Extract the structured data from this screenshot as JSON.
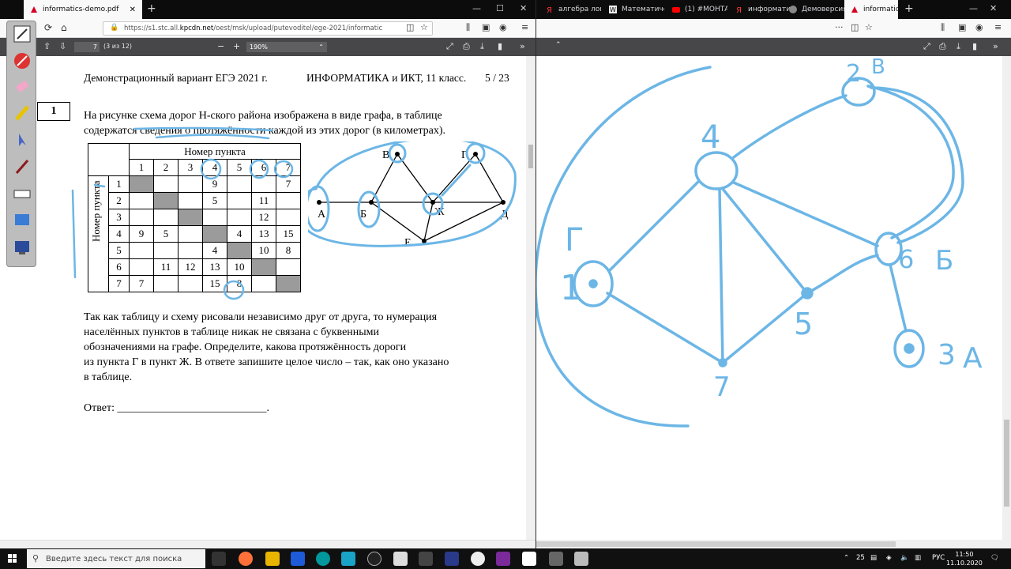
{
  "left_window": {
    "tabs": [
      {
        "label": "informatics-demo.pdf",
        "active": true
      }
    ],
    "url": {
      "prefix": "https://s1.stc.all.",
      "domain": "kpcdn.net",
      "path": "/oest/msk/upload/putevoditel/ege-2021/informatic"
    },
    "pdf_toolbar": {
      "page_value": "7",
      "page_count": "(3 из 12)",
      "zoom": "190%"
    },
    "document": {
      "header_left": "Демонстрационный вариант ЕГЭ 2021 г.",
      "header_mid": "ИНФОРМАТИКА и ИКТ, 11 класс.",
      "header_right": "5 / 23",
      "task_number": "1",
      "intro_line1": "На рисунке схема дорог Н-ского района изображена в виде графа, в таблице",
      "intro_line2": "содержатся сведения о протяжённости каждой из этих дорог (в километрах).",
      "table": {
        "top_header": "Номер пункта",
        "side_header": "Номер пункта",
        "cols": [
          "1",
          "2",
          "3",
          "4",
          "5",
          "6",
          "7"
        ],
        "rows": [
          [
            "",
            "",
            "",
            "9",
            "",
            "",
            "7"
          ],
          [
            "",
            "",
            "",
            "5",
            "",
            "11",
            ""
          ],
          [
            "",
            "",
            "",
            "",
            "",
            "12",
            ""
          ],
          [
            "9",
            "5",
            "",
            "",
            "4",
            "13",
            "15"
          ],
          [
            "",
            "",
            "",
            "4",
            "",
            "10",
            "8"
          ],
          [
            "",
            "11",
            "12",
            "13",
            "10",
            "",
            ""
          ],
          [
            "7",
            "",
            "",
            "15",
            "8",
            "",
            ""
          ]
        ]
      },
      "graph_labels": {
        "A": "А",
        "B": "Б",
        "V": "В",
        "G": "Г",
        "D": "Д",
        "E": "Е",
        "Zh": "Ж"
      },
      "body_l1": "Так как таблицу и схему рисовали независимо друг от друга, то нумерация",
      "body_l2": "населённых пунктов в таблице никак не связана с буквенными",
      "body_l3": "обозначениями на графе. Определите, какова протяжённость дороги",
      "body_l4": "из пункта Г в пункт Ж. В ответе запишите целое число – так, как оно указано",
      "body_l5": "в таблице.",
      "answer_label": "Ответ:",
      "answer_line": "___________________________."
    }
  },
  "right_window": {
    "tabs": [
      {
        "label": "алгебра логи"
      },
      {
        "label": "Математиче"
      },
      {
        "label": "(1) #МОНТАЖ"
      },
      {
        "label": "информатик"
      },
      {
        "label": "Демоверсия"
      },
      {
        "label": "informatic",
        "active": true
      }
    ],
    "handwriting": {
      "n1": "1",
      "n2": "2",
      "n3": "3",
      "n4": "4",
      "n5": "5",
      "n6": "6",
      "n7": "7",
      "lG": "Г",
      "lB": "Б",
      "lV": "В",
      "lA": "А"
    }
  },
  "taskbar": {
    "search_placeholder": "Введите здесь текст для поиска",
    "lang": "РУС",
    "time": "11:50",
    "date": "11.10.2020",
    "temp": "25"
  },
  "colors": {
    "ink": "#6cb6e6",
    "pdf_toolbar": "#474749",
    "tabbar": "#0c0c0d"
  }
}
